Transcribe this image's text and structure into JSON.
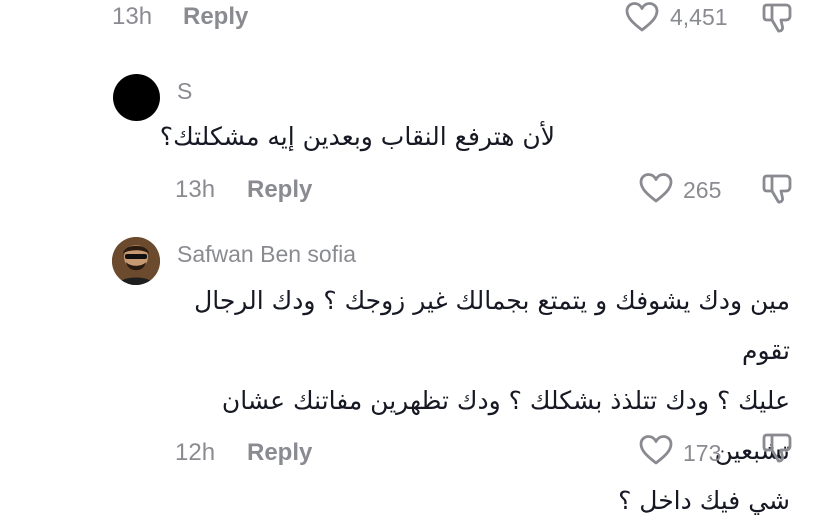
{
  "top_action_row": {
    "time": "13h",
    "reply_label": "Reply",
    "like_count": "4,451",
    "like_icon": "heart-outline-icon",
    "dislike_icon": "thumbs-down-icon"
  },
  "comments": [
    {
      "author": "S",
      "avatar_color": "#000000",
      "text": "لأن هترفع النقاب وبعدين إيه مشكلتك؟",
      "time": "13h",
      "reply_label": "Reply",
      "like_count": "265"
    },
    {
      "author": "Safwan Ben sofia",
      "text_lines": [
        "مين ودك يشوفك و يتمتع بجمالك غير زوجك ؟ ودك الرجال تقوم",
        "عليك ؟ ودك تتلذذ بشكلك ؟ ودك تظهرين مفاتنك عشان تشبعين",
        "شي فيك داخل ؟"
      ],
      "time": "12h",
      "reply_label": "Reply",
      "like_count": "173"
    }
  ],
  "colors": {
    "text_primary": "#161823",
    "text_secondary": "#8a8b91",
    "icon": "#8a8b91"
  }
}
